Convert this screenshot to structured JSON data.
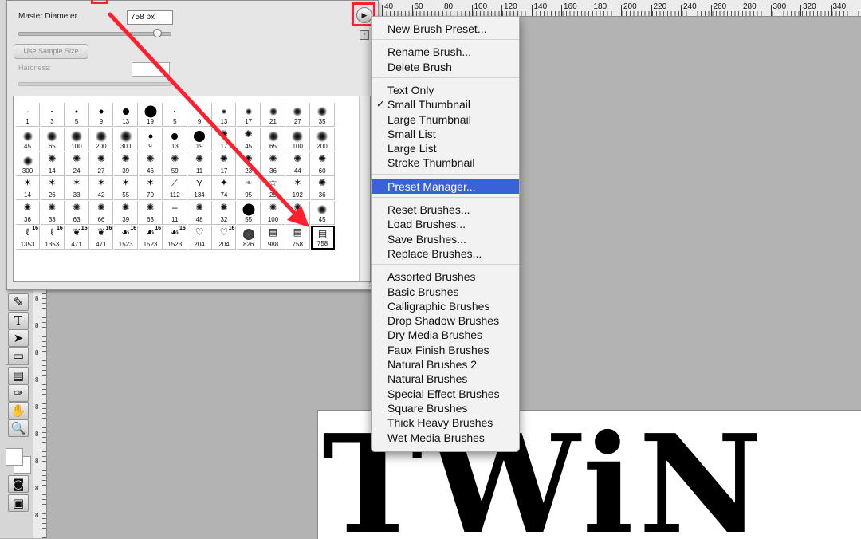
{
  "brush_panel": {
    "master_diameter_label": "Master Diameter",
    "master_diameter_value": "758 px",
    "use_sample_size_label": "Use Sample Size",
    "hardness_label": "Hardness:",
    "master_diameter_slider_fraction": 0.9,
    "brushes": [
      {
        "size": "1",
        "kind": "dot",
        "d": 1
      },
      {
        "size": "3",
        "kind": "dot",
        "d": 2
      },
      {
        "size": "5",
        "kind": "dot",
        "d": 3
      },
      {
        "size": "9",
        "kind": "dot",
        "d": 5
      },
      {
        "size": "13",
        "kind": "dot",
        "d": 8
      },
      {
        "size": "19",
        "kind": "dot",
        "d": 15
      },
      {
        "size": "5",
        "kind": "dot",
        "d": 2
      },
      {
        "size": "9",
        "kind": "dot",
        "d": 3
      },
      {
        "size": "13",
        "kind": "soft",
        "d": 6
      },
      {
        "size": "17",
        "kind": "soft",
        "d": 8
      },
      {
        "size": "21",
        "kind": "soft",
        "d": 10
      },
      {
        "size": "27",
        "kind": "soft",
        "d": 11
      },
      {
        "size": "35",
        "kind": "soft",
        "d": 12
      },
      {
        "size": "45",
        "kind": "soft",
        "d": 12
      },
      {
        "size": "65",
        "kind": "soft",
        "d": 13
      },
      {
        "size": "100",
        "kind": "soft",
        "d": 14
      },
      {
        "size": "200",
        "kind": "soft",
        "d": 14
      },
      {
        "size": "300",
        "kind": "soft",
        "d": 15
      },
      {
        "size": "9",
        "kind": "dot",
        "d": 5
      },
      {
        "size": "13",
        "kind": "dot",
        "d": 8
      },
      {
        "size": "19",
        "kind": "dot",
        "d": 14
      },
      {
        "size": "17",
        "kind": "spatter"
      },
      {
        "size": "45",
        "kind": "spatter"
      },
      {
        "size": "65",
        "kind": "soft",
        "d": 13
      },
      {
        "size": "100",
        "kind": "soft",
        "d": 14
      },
      {
        "size": "200",
        "kind": "soft",
        "d": 14
      },
      {
        "size": "300",
        "kind": "soft",
        "d": 12
      },
      {
        "size": "14",
        "kind": "spatter"
      },
      {
        "size": "24",
        "kind": "spatter"
      },
      {
        "size": "27",
        "kind": "spatter"
      },
      {
        "size": "39",
        "kind": "spatter"
      },
      {
        "size": "46",
        "kind": "spatter"
      },
      {
        "size": "59",
        "kind": "spatter"
      },
      {
        "size": "11",
        "kind": "spatter"
      },
      {
        "size": "17",
        "kind": "spatter"
      },
      {
        "size": "23",
        "kind": "spatter"
      },
      {
        "size": "36",
        "kind": "spatter"
      },
      {
        "size": "44",
        "kind": "spatter"
      },
      {
        "size": "60",
        "kind": "spatter"
      },
      {
        "size": "14",
        "kind": "star"
      },
      {
        "size": "26",
        "kind": "star"
      },
      {
        "size": "33",
        "kind": "star"
      },
      {
        "size": "42",
        "kind": "star"
      },
      {
        "size": "55",
        "kind": "star"
      },
      {
        "size": "70",
        "kind": "star"
      },
      {
        "size": "112",
        "kind": "glyph",
        "g": "⟋"
      },
      {
        "size": "134",
        "kind": "glyph",
        "g": "⋎"
      },
      {
        "size": "74",
        "kind": "glyph",
        "g": "✦"
      },
      {
        "size": "95",
        "kind": "leaf"
      },
      {
        "size": "29",
        "kind": "glyph",
        "g": "☆"
      },
      {
        "size": "192",
        "kind": "star"
      },
      {
        "size": "36",
        "kind": "spatter"
      },
      {
        "size": "36",
        "kind": "spatter"
      },
      {
        "size": "33",
        "kind": "spatter"
      },
      {
        "size": "63",
        "kind": "spatter"
      },
      {
        "size": "66",
        "kind": "spatter"
      },
      {
        "size": "39",
        "kind": "spatter"
      },
      {
        "size": "63",
        "kind": "spatter"
      },
      {
        "size": "11",
        "kind": "glyph",
        "g": "–"
      },
      {
        "size": "48",
        "kind": "spatter"
      },
      {
        "size": "32",
        "kind": "spatter"
      },
      {
        "size": "55",
        "kind": "dot",
        "d": 15
      },
      {
        "size": "100",
        "kind": "spatter"
      },
      {
        "size": "",
        "kind": "spatter"
      },
      {
        "size": "45",
        "kind": "soft",
        "d": 12
      },
      {
        "size": "1353",
        "kind": "glyph",
        "g": "ℓ",
        "b16": true
      },
      {
        "size": "1353",
        "kind": "glyph",
        "g": "ℓ",
        "b16": true
      },
      {
        "size": "471",
        "kind": "glyph",
        "g": "❦",
        "b16": true
      },
      {
        "size": "471",
        "kind": "glyph",
        "g": "❦",
        "b16": true
      },
      {
        "size": "1523",
        "kind": "glyph",
        "g": "☙",
        "b16": true
      },
      {
        "size": "1523",
        "kind": "glyph",
        "g": "☙",
        "b16": true
      },
      {
        "size": "1523",
        "kind": "glyph",
        "g": "☙",
        "b16": true
      },
      {
        "size": "204",
        "kind": "glyph",
        "g": "♡"
      },
      {
        "size": "204",
        "kind": "glyph",
        "g": "♡",
        "b16": true
      },
      {
        "size": "826",
        "kind": "disc"
      },
      {
        "size": "988",
        "kind": "text"
      },
      {
        "size": "758",
        "kind": "text"
      },
      {
        "size": "758",
        "kind": "text",
        "selected": true
      }
    ]
  },
  "panel_menu": {
    "items": [
      {
        "label": "New Brush Preset...",
        "sep_before": false
      },
      {
        "label": "Rename Brush...",
        "sep_before": true
      },
      {
        "label": "Delete Brush",
        "sep_before": false
      },
      {
        "label": "Text Only",
        "sep_before": true
      },
      {
        "label": "Small Thumbnail",
        "sep_before": false,
        "checked": true
      },
      {
        "label": "Large Thumbnail",
        "sep_before": false
      },
      {
        "label": "Small List",
        "sep_before": false
      },
      {
        "label": "Large List",
        "sep_before": false
      },
      {
        "label": "Stroke Thumbnail",
        "sep_before": false
      },
      {
        "label": "Preset Manager...",
        "sep_before": true,
        "active": true
      },
      {
        "label": "Reset Brushes...",
        "sep_before": true
      },
      {
        "label": "Load Brushes...",
        "sep_before": false
      },
      {
        "label": "Save Brushes...",
        "sep_before": false
      },
      {
        "label": "Replace Brushes...",
        "sep_before": false
      },
      {
        "label": "Assorted Brushes",
        "sep_before": true
      },
      {
        "label": "Basic Brushes",
        "sep_before": false
      },
      {
        "label": "Calligraphic Brushes",
        "sep_before": false
      },
      {
        "label": "Drop Shadow Brushes",
        "sep_before": false
      },
      {
        "label": "Dry Media Brushes",
        "sep_before": false
      },
      {
        "label": "Faux Finish Brushes",
        "sep_before": false
      },
      {
        "label": "Natural Brushes 2",
        "sep_before": false
      },
      {
        "label": "Natural Brushes",
        "sep_before": false
      },
      {
        "label": "Special Effect Brushes",
        "sep_before": false
      },
      {
        "label": "Square Brushes",
        "sep_before": false
      },
      {
        "label": "Thick Heavy Brushes",
        "sep_before": false
      },
      {
        "label": "Wet Media Brushes",
        "sep_before": false
      }
    ],
    "checkmark": "✓"
  },
  "ruler": {
    "h_labels": [
      "40",
      "60",
      "80",
      "100",
      "120",
      "140",
      "160",
      "180",
      "200",
      "220",
      "240",
      "260",
      "280",
      "300",
      "320",
      "340"
    ],
    "v_labels": [
      "8",
      "8",
      "8",
      "8",
      "8",
      "8",
      "8",
      "8",
      "8"
    ]
  },
  "toolbar": {
    "tools": [
      {
        "name": "pen-tool-icon",
        "glyph": "✎"
      },
      {
        "name": "type-tool-icon",
        "glyph": "T"
      },
      {
        "name": "path-selection-tool-icon",
        "glyph": "➤"
      },
      {
        "name": "shape-tool-icon",
        "glyph": "▭"
      },
      {
        "name": "notes-tool-icon",
        "glyph": "▤"
      },
      {
        "name": "eyedropper-tool-icon",
        "glyph": "✑"
      },
      {
        "name": "hand-tool-icon",
        "glyph": "✋"
      },
      {
        "name": "zoom-tool-icon",
        "glyph": "🔍"
      }
    ]
  },
  "canvas": {
    "art_text": "TWiN"
  },
  "colors": {
    "highlight_red": "#ff1f2f",
    "menu_active": "#3a62d8"
  }
}
